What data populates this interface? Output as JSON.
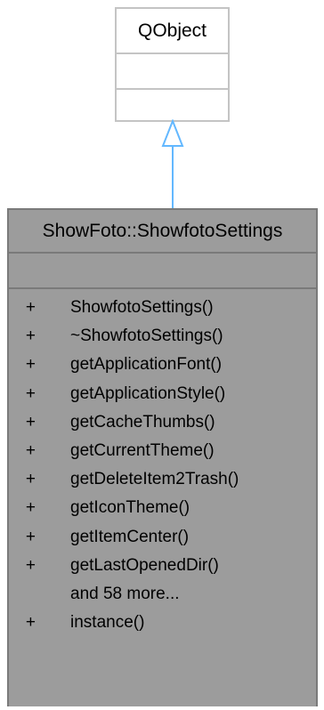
{
  "base_class": {
    "name": "QObject"
  },
  "derived_class": {
    "name": "ShowFoto::ShowfotoSettings",
    "members": [
      {
        "visibility": "+",
        "name": "ShowfotoSettings()"
      },
      {
        "visibility": "+",
        "name": "~ShowfotoSettings()"
      },
      {
        "visibility": "+",
        "name": "getApplicationFont()"
      },
      {
        "visibility": "+",
        "name": "getApplicationStyle()"
      },
      {
        "visibility": "+",
        "name": "getCacheThumbs()"
      },
      {
        "visibility": "+",
        "name": "getCurrentTheme()"
      },
      {
        "visibility": "+",
        "name": "getDeleteItem2Trash()"
      },
      {
        "visibility": "+",
        "name": "getIconTheme()"
      },
      {
        "visibility": "+",
        "name": "getItemCenter()"
      },
      {
        "visibility": "+",
        "name": "getLastOpenedDir()"
      },
      {
        "visibility": "",
        "name": "and 58 more..."
      },
      {
        "visibility": "+",
        "name": "instance()"
      }
    ]
  },
  "colors": {
    "base_border": "#c4c4c4",
    "derived_fill": "#9c9c9c",
    "derived_border": "#7a7a7a",
    "arrow": "#63b8ff"
  }
}
